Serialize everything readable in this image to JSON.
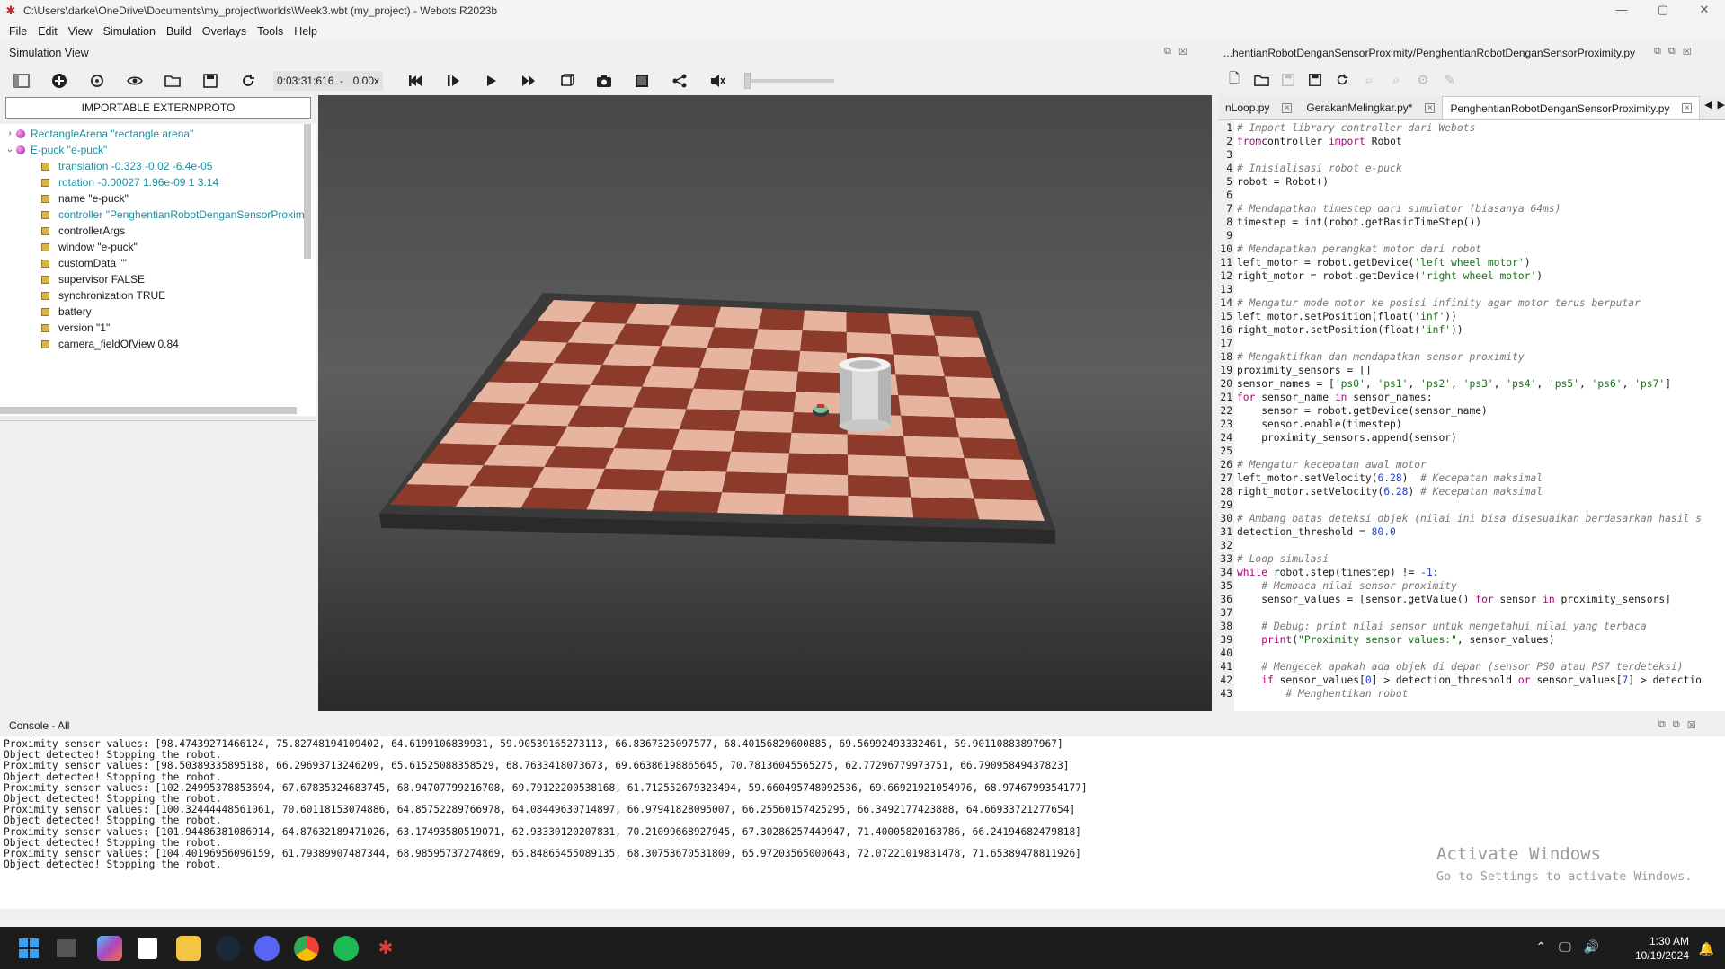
{
  "window": {
    "title": "C:\\Users\\darke\\OneDrive\\Documents\\my_project\\worlds\\Week3.wbt (my_project) - Webots R2023b",
    "controls": [
      "—",
      "▢",
      "✕"
    ]
  },
  "menu": [
    "File",
    "Edit",
    "View",
    "Simulation",
    "Build",
    "Overlays",
    "Tools",
    "Help"
  ],
  "sim_view": {
    "label": "Simulation View",
    "time": "0:03:31:616",
    "speed_sep": "-",
    "speed": "0.00x"
  },
  "scene_tree": {
    "import_button": "IMPORTABLE EXTERNPROTO",
    "nodes": [
      {
        "label": "RectangleArena \"rectangle arena\"",
        "kind": "proto",
        "expanded": false,
        "color": "cyan"
      },
      {
        "label": "E-puck \"e-puck\"",
        "kind": "proto",
        "expanded": true,
        "color": "cyan"
      },
      {
        "label": "translation -0.323 -0.02 -6.4e-05",
        "kind": "field",
        "color": "cyan"
      },
      {
        "label": "rotation -0.00027 1.96e-09 1 3.14",
        "kind": "field",
        "color": "cyan"
      },
      {
        "label": "name \"e-puck\"",
        "kind": "field",
        "color": "black"
      },
      {
        "label": "controller \"PenghentianRobotDenganSensorProximit",
        "kind": "field",
        "color": "cyan"
      },
      {
        "label": "controllerArgs",
        "kind": "field",
        "color": "black"
      },
      {
        "label": "window \"e-puck\"",
        "kind": "field",
        "color": "black"
      },
      {
        "label": "customData \"\"",
        "kind": "field",
        "color": "black"
      },
      {
        "label": "supervisor FALSE",
        "kind": "field",
        "color": "black"
      },
      {
        "label": "synchronization TRUE",
        "kind": "field",
        "color": "black"
      },
      {
        "label": "battery",
        "kind": "field",
        "color": "black"
      },
      {
        "label": "version \"1\"",
        "kind": "field",
        "color": "black"
      },
      {
        "label": "camera_fieldOfView 0.84",
        "kind": "field",
        "color": "black"
      }
    ]
  },
  "editor": {
    "path": "...hentianRobotDenganSensorProximity/PenghentianRobotDenganSensorProximity.py",
    "tabs": [
      {
        "label": "nLoop.py",
        "active": false
      },
      {
        "label": "GerakanMelingkar.py*",
        "active": false
      },
      {
        "label": "PenghentianRobotDenganSensorProximity.py",
        "active": true
      }
    ],
    "lines": [
      [
        [
          "cm",
          "# Import library controller dari Webots"
        ]
      ],
      [
        [
          "kw",
          "from"
        ],
        [
          "",
          "controller "
        ],
        [
          "kw",
          "import"
        ],
        [
          "",
          " Robot"
        ]
      ],
      [
        [
          "",
          ""
        ]
      ],
      [
        [
          "cm",
          "# Inisialisasi robot e-puck"
        ]
      ],
      [
        [
          "",
          "robot = Robot()"
        ]
      ],
      [
        [
          "",
          ""
        ]
      ],
      [
        [
          "cm",
          "# Mendapatkan timestep dari simulator (biasanya 64ms)"
        ]
      ],
      [
        [
          "",
          "timestep = int(robot.getBasicTimeStep())"
        ]
      ],
      [
        [
          "",
          ""
        ]
      ],
      [
        [
          "cm",
          "# Mendapatkan perangkat motor dari robot"
        ]
      ],
      [
        [
          "",
          "left_motor = robot.getDevice("
        ],
        [
          "st",
          "'left wheel motor'"
        ],
        [
          "",
          ")"
        ]
      ],
      [
        [
          "",
          "right_motor = robot.getDevice("
        ],
        [
          "st",
          "'right wheel motor'"
        ],
        [
          "",
          ")"
        ]
      ],
      [
        [
          "",
          ""
        ]
      ],
      [
        [
          "cm",
          "# Mengatur mode motor ke posisi infinity agar motor terus berputar"
        ]
      ],
      [
        [
          "",
          "left_motor.setPosition(float("
        ],
        [
          "st",
          "'inf'"
        ],
        [
          "",
          "))"
        ]
      ],
      [
        [
          "",
          "right_motor.setPosition(float("
        ],
        [
          "st",
          "'inf'"
        ],
        [
          "",
          "))"
        ]
      ],
      [
        [
          "",
          ""
        ]
      ],
      [
        [
          "cm",
          "# Mengaktifkan dan mendapatkan sensor proximity"
        ]
      ],
      [
        [
          "",
          "proximity_sensors = []"
        ]
      ],
      [
        [
          "",
          "sensor_names = ["
        ],
        [
          "st",
          "'ps0'"
        ],
        [
          "",
          ", "
        ],
        [
          "st",
          "'ps1'"
        ],
        [
          "",
          ", "
        ],
        [
          "st",
          "'ps2'"
        ],
        [
          "",
          ", "
        ],
        [
          "st",
          "'ps3'"
        ],
        [
          "",
          ", "
        ],
        [
          "st",
          "'ps4'"
        ],
        [
          "",
          ", "
        ],
        [
          "st",
          "'ps5'"
        ],
        [
          "",
          ", "
        ],
        [
          "st",
          "'ps6'"
        ],
        [
          "",
          ", "
        ],
        [
          "st",
          "'ps7'"
        ],
        [
          "",
          "]"
        ]
      ],
      [
        [
          "kw",
          "for"
        ],
        [
          "",
          " sensor_name "
        ],
        [
          "kw",
          "in"
        ],
        [
          "",
          " sensor_names:"
        ]
      ],
      [
        [
          "",
          "    sensor = robot.getDevice(sensor_name)"
        ]
      ],
      [
        [
          "",
          "    sensor.enable(timestep)"
        ]
      ],
      [
        [
          "",
          "    proximity_sensors.append(sensor)"
        ]
      ],
      [
        [
          "",
          ""
        ]
      ],
      [
        [
          "cm",
          "# Mengatur kecepatan awal motor"
        ]
      ],
      [
        [
          "",
          "left_motor.setVelocity("
        ],
        [
          "nu",
          "6.28"
        ],
        [
          "",
          ")  "
        ],
        [
          "cm",
          "# Kecepatan maksimal"
        ]
      ],
      [
        [
          "",
          "right_motor.setVelocity("
        ],
        [
          "nu",
          "6.28"
        ],
        [
          "",
          ") "
        ],
        [
          "cm",
          "# Kecepatan maksimal"
        ]
      ],
      [
        [
          "",
          ""
        ]
      ],
      [
        [
          "cm",
          "# Ambang batas deteksi objek (nilai ini bisa disesuaikan berdasarkan hasil s"
        ]
      ],
      [
        [
          "",
          "detection_threshold = "
        ],
        [
          "nu",
          "80.0"
        ]
      ],
      [
        [
          "",
          ""
        ]
      ],
      [
        [
          "cm",
          "# Loop simulasi"
        ]
      ],
      [
        [
          "kw",
          "while"
        ],
        [
          "",
          " robot.step(timestep) != "
        ],
        [
          "nu",
          "-1"
        ],
        [
          "",
          ":"
        ]
      ],
      [
        [
          "",
          "    "
        ],
        [
          "cm",
          "# Membaca nilai sensor proximity"
        ]
      ],
      [
        [
          "",
          "    sensor_values = [sensor.getValue() "
        ],
        [
          "kw",
          "for"
        ],
        [
          "",
          " sensor "
        ],
        [
          "kw",
          "in"
        ],
        [
          "",
          " proximity_sensors]"
        ]
      ],
      [
        [
          "",
          ""
        ]
      ],
      [
        [
          "",
          "    "
        ],
        [
          "cm",
          "# Debug: print nilai sensor untuk mengetahui nilai yang terbaca"
        ]
      ],
      [
        [
          "",
          "    "
        ],
        [
          "kw",
          "print"
        ],
        [
          "",
          "("
        ],
        [
          "st",
          "\"Proximity sensor values:\""
        ],
        [
          "",
          ", sensor_values)"
        ]
      ],
      [
        [
          "",
          ""
        ]
      ],
      [
        [
          "",
          "    "
        ],
        [
          "cm",
          "# Mengecek apakah ada objek di depan (sensor PS0 atau PS7 terdeteksi)"
        ]
      ],
      [
        [
          "",
          "    "
        ],
        [
          "kw",
          "if"
        ],
        [
          "",
          " sensor_values["
        ],
        [
          "nu",
          "0"
        ],
        [
          "",
          "] > detection_threshold "
        ],
        [
          "kw",
          "or"
        ],
        [
          "",
          " sensor_values["
        ],
        [
          "nu",
          "7"
        ],
        [
          "",
          "] > detectio"
        ]
      ],
      [
        [
          "",
          "        "
        ],
        [
          "cm",
          "# Menghentikan robot"
        ]
      ]
    ]
  },
  "console": {
    "label": "Console - All",
    "lines": [
      "Proximity sensor values: [98.47439271466124, 75.82748194109402, 64.6199106839931, 59.90539165273113, 66.8367325097577, 68.40156829600885, 69.56992493332461, 59.90110883897967]",
      "Object detected! Stopping the robot.",
      "Proximity sensor values: [98.50389335895188, 66.29693713246209, 65.61525088358529, 68.7633418073673, 69.66386198865645, 70.78136045565275, 62.77296779973751, 66.79095849437823]",
      "Object detected! Stopping the robot.",
      "Proximity sensor values: [102.24995378853694, 67.67835324683745, 68.94707799216708, 69.79122200538168, 61.712552679323494, 59.660495748092536, 69.66921921054976, 68.9746799354177]",
      "Object detected! Stopping the robot.",
      "Proximity sensor values: [100.32444448561061, 70.60118153074886, 64.85752289766978, 64.08449630714897, 66.97941828095007, 66.25560157425295, 66.3492177423888, 64.66933721277654]",
      "Object detected! Stopping the robot.",
      "Proximity sensor values: [101.94486381086914, 64.87632189471026, 63.17493580519071, 62.93330120207831, 70.21099668927945, 67.30286257449947, 71.40005820163786, 66.24194682479818]",
      "Object detected! Stopping the robot.",
      "Proximity sensor values: [104.40196956096159, 61.79389907487344, 68.98595737274869, 65.84865455089135, 68.30753670531809, 65.97203565000643, 72.07221019831478, 71.65389478811926]",
      "Object detected! Stopping the robot."
    ],
    "watermark_title": "Activate Windows",
    "watermark_sub": "Go to Settings to activate Windows."
  },
  "taskbar": {
    "time": "1:30 AM",
    "date": "10/19/2024"
  }
}
